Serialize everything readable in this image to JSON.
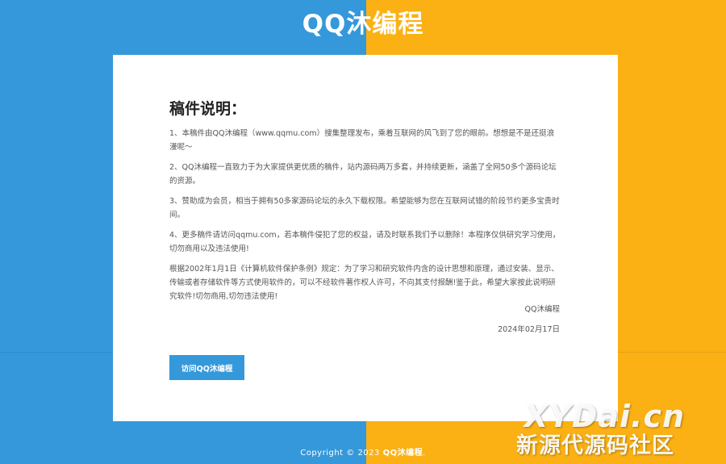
{
  "site": {
    "title": "QQ沐编程"
  },
  "colors": {
    "left_bg": "#3498db",
    "right_bg": "#fbb114",
    "button": "#3498db"
  },
  "card": {
    "heading": "稿件说明：",
    "paragraphs": [
      "1、本稿件由QQ沐编程（www.qqmu.com）搜集整理发布，乘着互联网的风飞到了您的眼前。想想是不是还挺浪漫呢～",
      "2、QQ沐编程一直致力于为大家提供更优质的稿件，站内源码两万多套，并持续更新，涵盖了全网50多个源码论坛的资源。",
      "3、赞助成为会员，相当于拥有50多家源码论坛的永久下载权限。希望能够为您在互联网试错的阶段节约更多宝贵时间。",
      "4、更多稿件请访问qqmu.com，若本稿件侵犯了您的权益，请及时联系我们予以删除！本程序仅供研究学习使用，切勿商用以及违法使用!",
      "根据2002年1月1日《计算机软件保护条例》规定：为了学习和研究软件内含的设计思想和原理，通过安装、显示、传输或者存储软件等方式使用软件的，可以不经软件著作权人许可，不向其支付报酬!鉴于此，希望大家按此说明研究软件!切勿商用,切勿违法使用!"
    ],
    "signature_name": "QQ沐编程",
    "signature_date": "2024年02月17日",
    "button_label": "访问QQ沐编程"
  },
  "footer": {
    "prefix": "Copyright © 2023 ",
    "brand": "QQ沐编程",
    "suffix": "."
  },
  "watermark": {
    "line1": "XYDai.cn",
    "line2": "新源代源码社区"
  }
}
